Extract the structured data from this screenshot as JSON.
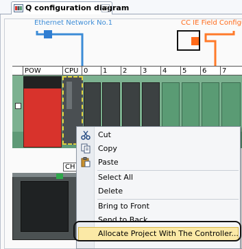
{
  "tab": {
    "title": "Q configuration diagram",
    "close_glyph": "×",
    "icon": "diagram-icon"
  },
  "networks": {
    "ethernet": {
      "label": "Ethernet Network No.1",
      "color": "#3b8bd6"
    },
    "cc_ie": {
      "label": "CC IE Field Configura",
      "color": "#ff6a1a"
    }
  },
  "slots": [
    "POW",
    "CPU",
    "0",
    "1",
    "2",
    "3",
    "4",
    "5",
    "6",
    "7"
  ],
  "ch_tag": "CH",
  "context_menu": {
    "items": [
      {
        "label": "Cut",
        "icon": "scissors-icon"
      },
      {
        "label": "Copy",
        "icon": "copy-icon"
      },
      {
        "label": "Paste",
        "icon": "paste-icon"
      },
      {
        "label": "Select All",
        "icon": ""
      },
      {
        "label": "Delete",
        "icon": ""
      },
      {
        "label": "Bring to Front",
        "icon": ""
      },
      {
        "label": "Send to Back",
        "icon": ""
      },
      {
        "label": "Allocate Project With The Controller...",
        "icon": ""
      }
    ],
    "highlighted_index": 7
  }
}
